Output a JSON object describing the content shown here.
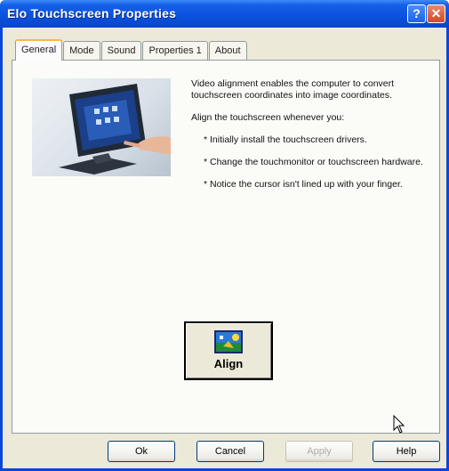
{
  "window": {
    "title": "Elo Touchscreen Properties",
    "help_glyph": "?",
    "close_glyph": "✕"
  },
  "tabs": [
    {
      "label": "General",
      "active": true
    },
    {
      "label": "Mode",
      "active": false
    },
    {
      "label": "Sound",
      "active": false
    },
    {
      "label": "Properties 1",
      "active": false
    },
    {
      "label": "About",
      "active": false
    }
  ],
  "general": {
    "intro": "Video alignment enables the computer to convert touchscreen coordinates into image coordinates.",
    "align_whenever": "Align the touchscreen whenever you:",
    "bullets": [
      "* Initially install the touchscreen drivers.",
      "* Change the touchmonitor or touchscreen hardware.",
      "* Notice the cursor isn't lined up with your finger."
    ],
    "align_button_label": "Align"
  },
  "buttons": {
    "ok": "Ok",
    "cancel": "Cancel",
    "apply": "Apply",
    "help": "Help"
  },
  "colors": {
    "titlebar": "#0a52e0",
    "dialog_bg": "#ece9d8",
    "active_tab_accent": "#f8b74a"
  }
}
